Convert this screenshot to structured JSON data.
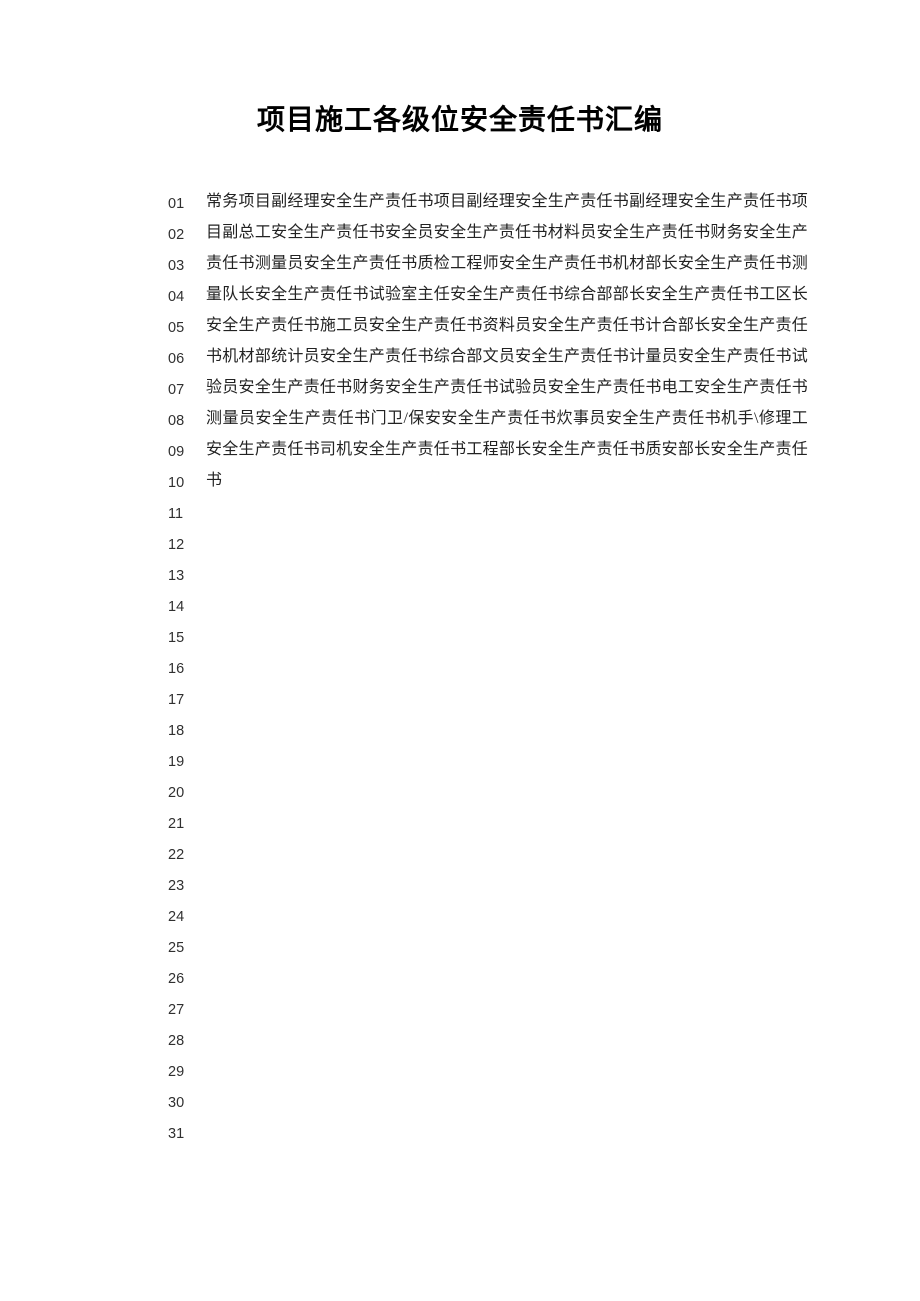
{
  "title": "项目施工各级位安全责任书汇编",
  "line_numbers": [
    "01",
    "02",
    "03",
    "04",
    "05",
    "06",
    "07",
    "08",
    "09",
    "10",
    "11",
    "12",
    "13",
    "14",
    "15",
    "16",
    "17",
    "18",
    "19",
    "20",
    "21",
    "22",
    "23",
    "24",
    "25",
    "26",
    "27",
    "28",
    "29",
    "30",
    "31"
  ],
  "body_text": "常务项目副经理安全生产责任书项目副经理安全生产责任书副经理安全生产责任书项目副总工安全生产责任书安全员安全生产责任书材料员安全生产责任书财务安全生产责任书测量员安全生产责任书质检工程师安全生产责任书机材部长安全生产责任书测量队长安全生产责任书试验室主任安全生产责任书综合部部长安全生产责任书工区长安全生产责任书施工员安全生产责任书资料员安全生产责任书计合部长安全生产责任书机材部统计员安全生产责任书综合部文员安全生产责任书计量员安全生产责任书试验员安全生产责任书财务安全生产责任书试验员安全生产责任书电工安全生产责任书测量员安全生产责任书门卫/保安安全生产责任书炊事员安全生产责任书机手\\修理工安全生产责任书司机安全生产责任书工程部长安全生产责任书质安部长安全生产责任书"
}
